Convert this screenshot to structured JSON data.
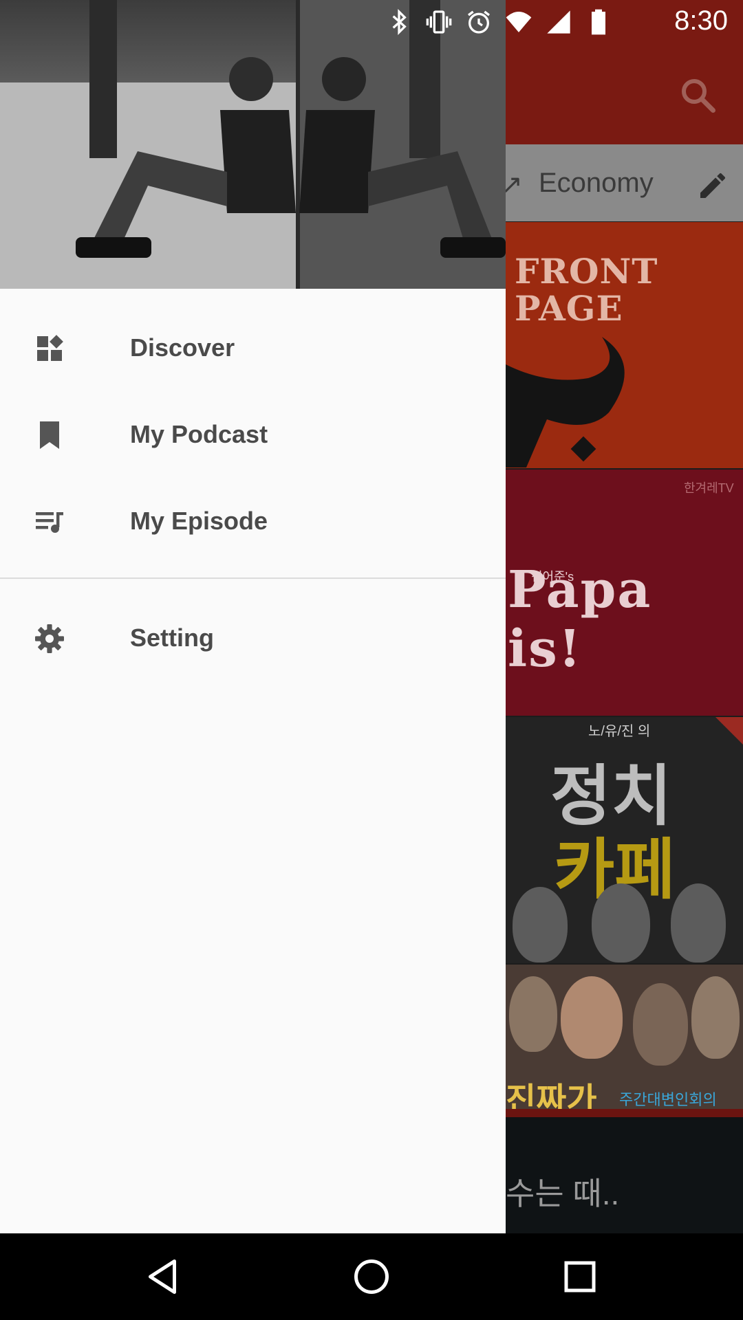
{
  "status_bar": {
    "time": "8:30",
    "icons": [
      "bluetooth-icon",
      "vibrate-icon",
      "alarm-icon",
      "wifi-icon",
      "cell-signal-icon",
      "battery-icon"
    ]
  },
  "drawer": {
    "header_image": "black-and-white photo of a man sitting against a mirror wall",
    "items": [
      {
        "label": "Discover",
        "icon": "dashboard-icon"
      },
      {
        "label": "My Podcast",
        "icon": "bookmark-icon"
      },
      {
        "label": "My Episode",
        "icon": "playlist-icon"
      }
    ],
    "settings": {
      "label": "Setting",
      "icon": "gear-icon"
    }
  },
  "background_app": {
    "toolbar_color": "#7a1a12",
    "tab_label": "Economy",
    "tiles": [
      {
        "lines": [
          "FRONT",
          "PAGE"
        ]
      },
      {
        "small": "한겨레TV",
        "mini": "김어준's",
        "title": "Papa is!"
      },
      {
        "small": "노/유/진 의",
        "line1": "정치",
        "line2": "카페"
      },
      {
        "banner": "진짜가",
        "sub": "주간대변인회의"
      },
      {
        "text": "수는 때.."
      }
    ]
  },
  "colors": {
    "drawer_bg": "#fafafa",
    "drawer_text": "#4a4a4a",
    "divider": "#dcdcdc"
  }
}
